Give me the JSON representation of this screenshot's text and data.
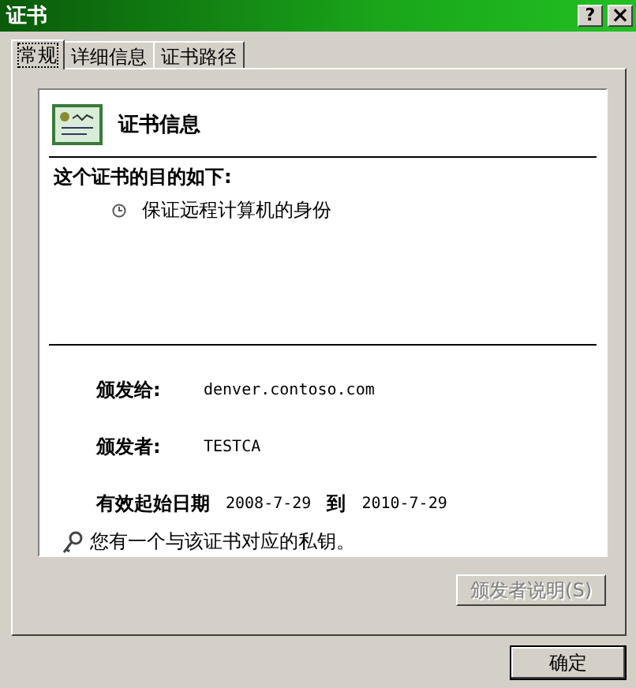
{
  "window": {
    "title": "证书",
    "buttons": [
      {
        "kind": "help",
        "label": "?"
      },
      {
        "kind": "close",
        "label": "×"
      }
    ]
  },
  "tabs": [
    {
      "label": "常规",
      "selected": true
    },
    {
      "label": "详细信息",
      "selected": false
    },
    {
      "label": "证书路径",
      "selected": false
    }
  ],
  "certificate": {
    "heading": "证书信息",
    "purpose_title": "这个证书的目的如下:",
    "purposes": [
      "保证远程计算机的身份"
    ],
    "fields": [
      {
        "label": "颁发给:",
        "value": "denver.contoso.com"
      },
      {
        "label": "颁发者:",
        "value": "TESTCA"
      }
    ],
    "validity": {
      "label": "有效起始日期",
      "from": "2008-7-29",
      "to_label": "到",
      "to": "2010-7-29"
    },
    "private_key_note": "您有一个与该证书对应的私钥。"
  },
  "issuer_button": {
    "label": "颁发者说明(S)",
    "disabled": true
  },
  "ok_button": {
    "label": "确定"
  }
}
